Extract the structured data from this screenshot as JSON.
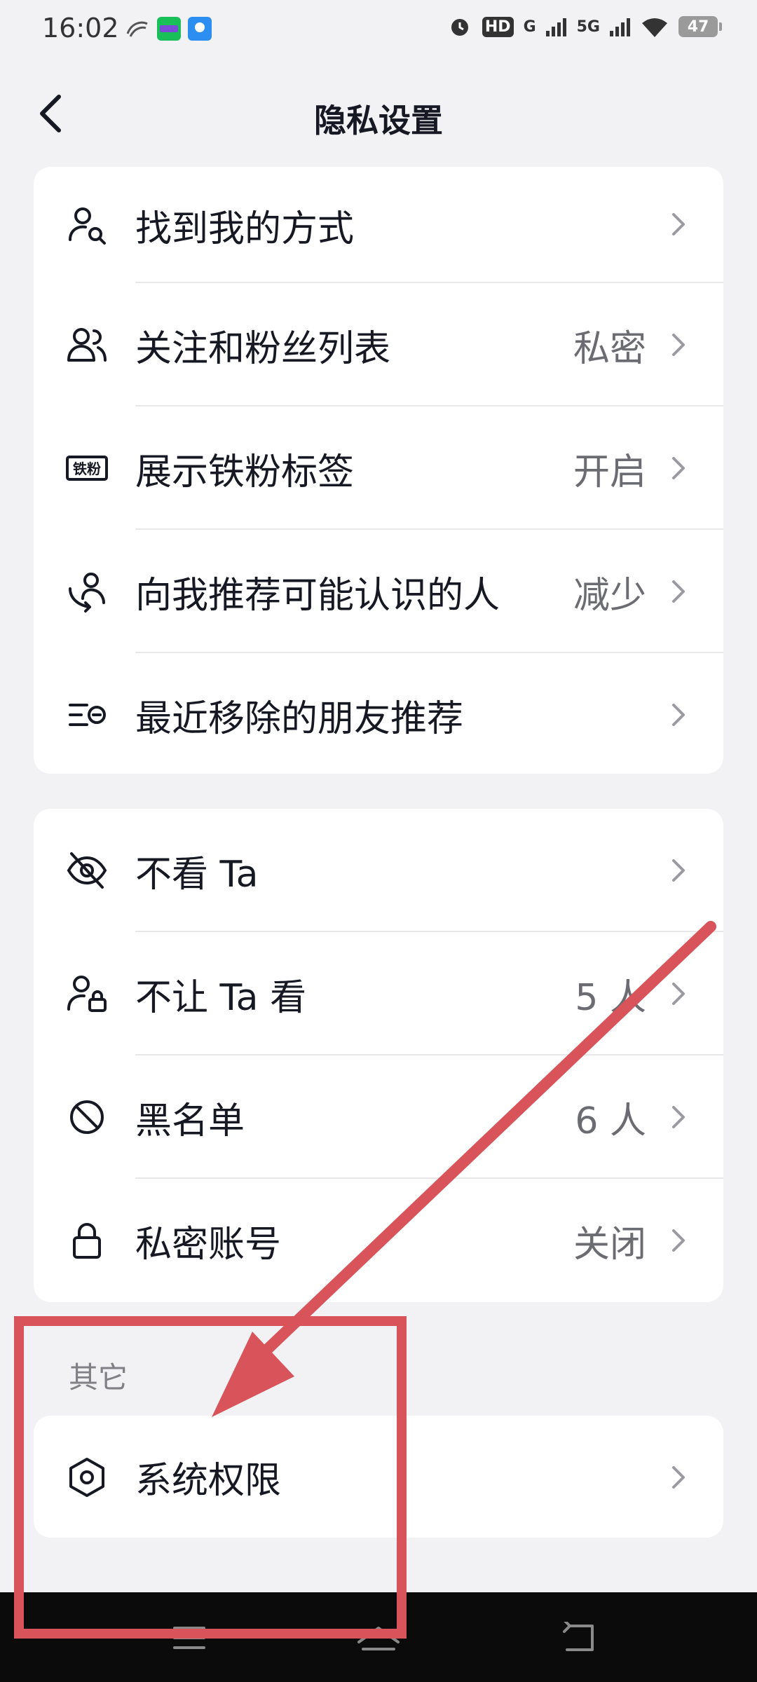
{
  "status_bar": {
    "time": "16:02",
    "network_1": "5G",
    "network_2": "G",
    "hd_label": "HD",
    "battery": "47"
  },
  "header": {
    "title": "隐私设置",
    "back_icon": "chevron-left-icon"
  },
  "group1": [
    {
      "label": "找到我的方式",
      "value": "",
      "icon": "person-search-icon"
    },
    {
      "label": "关注和粉丝列表",
      "value": "私密",
      "icon": "people-icon"
    },
    {
      "label": "展示铁粉标签",
      "value": "开启",
      "icon": "tiefen-badge-icon",
      "badge_text": "铁粉"
    },
    {
      "label": "向我推荐可能认识的人",
      "value": "减少",
      "icon": "recommend-person-icon"
    },
    {
      "label": "最近移除的朋友推荐",
      "value": "",
      "icon": "list-remove-icon"
    }
  ],
  "group2": [
    {
      "label": "不看 Ta",
      "value": "",
      "icon": "eye-off-icon"
    },
    {
      "label": "不让 Ta 看",
      "value": "5 人",
      "icon": "person-lock-icon"
    },
    {
      "label": "黑名单",
      "value": "6 人",
      "icon": "block-icon"
    },
    {
      "label": "私密账号",
      "value": "关闭",
      "icon": "lock-icon"
    }
  ],
  "section_other": {
    "label": "其它",
    "items": [
      {
        "label": "系统权限",
        "value": "",
        "icon": "hexagon-settings-icon"
      }
    ]
  },
  "nav_bar": {
    "icons": [
      "menu-icon",
      "home-icon",
      "back-icon"
    ]
  },
  "colors": {
    "background": "#f2f2f4",
    "card": "#ffffff",
    "annotation": "#d9535b",
    "value_text": "#6b6b72"
  }
}
